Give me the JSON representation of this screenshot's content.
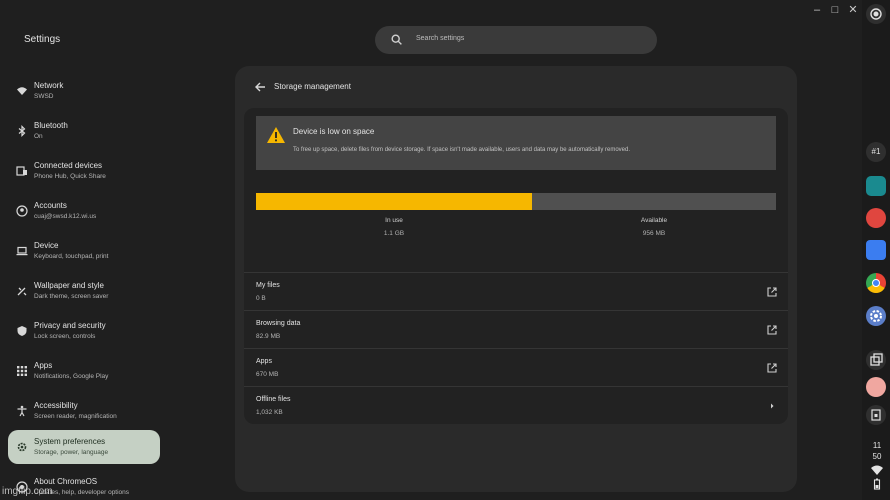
{
  "window": {
    "minimize_glyph": "–",
    "maximize_glyph": "□",
    "close_glyph": "✕"
  },
  "app_title": "Settings",
  "search": {
    "placeholder": "Search settings"
  },
  "sidebar": {
    "items": [
      {
        "label": "Network",
        "sub": "SWSD",
        "icon": "wifi-icon"
      },
      {
        "label": "Bluetooth",
        "sub": "On",
        "icon": "bluetooth-icon"
      },
      {
        "label": "Connected devices",
        "sub": "Phone Hub, Quick Share",
        "icon": "devices-icon"
      },
      {
        "label": "Accounts",
        "sub": "cuaj@swsd.k12.wi.us",
        "icon": "account-icon"
      },
      {
        "label": "Device",
        "sub": "Keyboard, touchpad, print",
        "icon": "laptop-icon"
      },
      {
        "label": "Wallpaper and style",
        "sub": "Dark theme, screen saver",
        "icon": "palette-icon"
      },
      {
        "label": "Privacy and security",
        "sub": "Lock screen, controls",
        "icon": "shield-icon"
      },
      {
        "label": "Apps",
        "sub": "Notifications, Google Play",
        "icon": "apps-grid-icon"
      },
      {
        "label": "Accessibility",
        "sub": "Screen reader, magnification",
        "icon": "accessibility-icon"
      },
      {
        "label": "System preferences",
        "sub": "Storage, power, language",
        "icon": "gear-icon",
        "active": true
      },
      {
        "label": "About ChromeOS",
        "sub": "Updates, help, developer options",
        "icon": "chromeos-icon"
      }
    ]
  },
  "page": {
    "title": "Storage management",
    "warning": {
      "title": "Device is low on space",
      "text": "To free up space, delete files from device storage. If space isn't made available, users and data may be automatically removed."
    },
    "usage": {
      "in_use_fraction": 0.53,
      "in_use_label": "In use",
      "in_use_value": "1.1 GB",
      "available_label": "Available",
      "available_value": "956 MB"
    },
    "rows": [
      {
        "label": "My files",
        "value": "0 B",
        "icon": "external-link-icon"
      },
      {
        "label": "Browsing data",
        "value": "82.9 MB",
        "icon": "external-link-icon"
      },
      {
        "label": "Apps",
        "value": "670 MB",
        "icon": "external-link-icon"
      },
      {
        "label": "Offline files",
        "value": "1,032 KB",
        "icon": "chevron-right-icon"
      }
    ]
  },
  "shelf": {
    "badge": "#1",
    "time_hour": "11",
    "time_min": "50"
  },
  "colors": {
    "accent_bar": "#f6b700",
    "warning_icon": "#f6b700",
    "active_nav": "#c5d0c4"
  },
  "watermark": "imgflip.com"
}
